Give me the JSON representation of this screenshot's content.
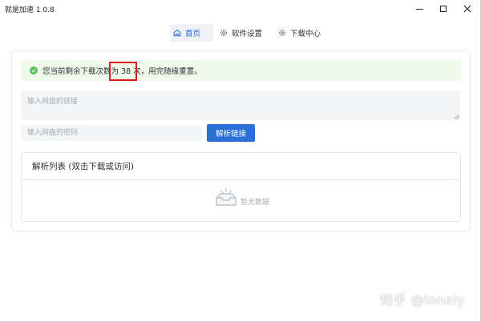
{
  "window": {
    "title": "就是加速  1.0.8"
  },
  "tabs": [
    {
      "label": "首页",
      "icon": "home-icon",
      "active": true
    },
    {
      "label": "软件设置",
      "icon": "gear-icon",
      "active": false
    },
    {
      "label": "下载中心",
      "icon": "gear-icon",
      "active": false
    }
  ],
  "alert": {
    "prefix": "您当前剩余下载次数为 ",
    "count": "38 次",
    "suffix": "，用完随缘重置。",
    "icon": "check-circle-icon",
    "color": "#5fc25a"
  },
  "link_input": {
    "placeholder": "输入网盘的链接",
    "value": ""
  },
  "password_input": {
    "placeholder": "输入网盘的密码",
    "value": ""
  },
  "parse_button": {
    "label": "解析链接",
    "color": "#2a6fd6"
  },
  "list": {
    "title": "解析列表 (双击下载或访问)",
    "empty_text": "暂无数据",
    "empty_icon": "empty-inbox-icon"
  },
  "watermark": {
    "text": "知乎 @lonely"
  },
  "colors": {
    "accent": "#2469c9",
    "highlight": "#e11a1a"
  }
}
